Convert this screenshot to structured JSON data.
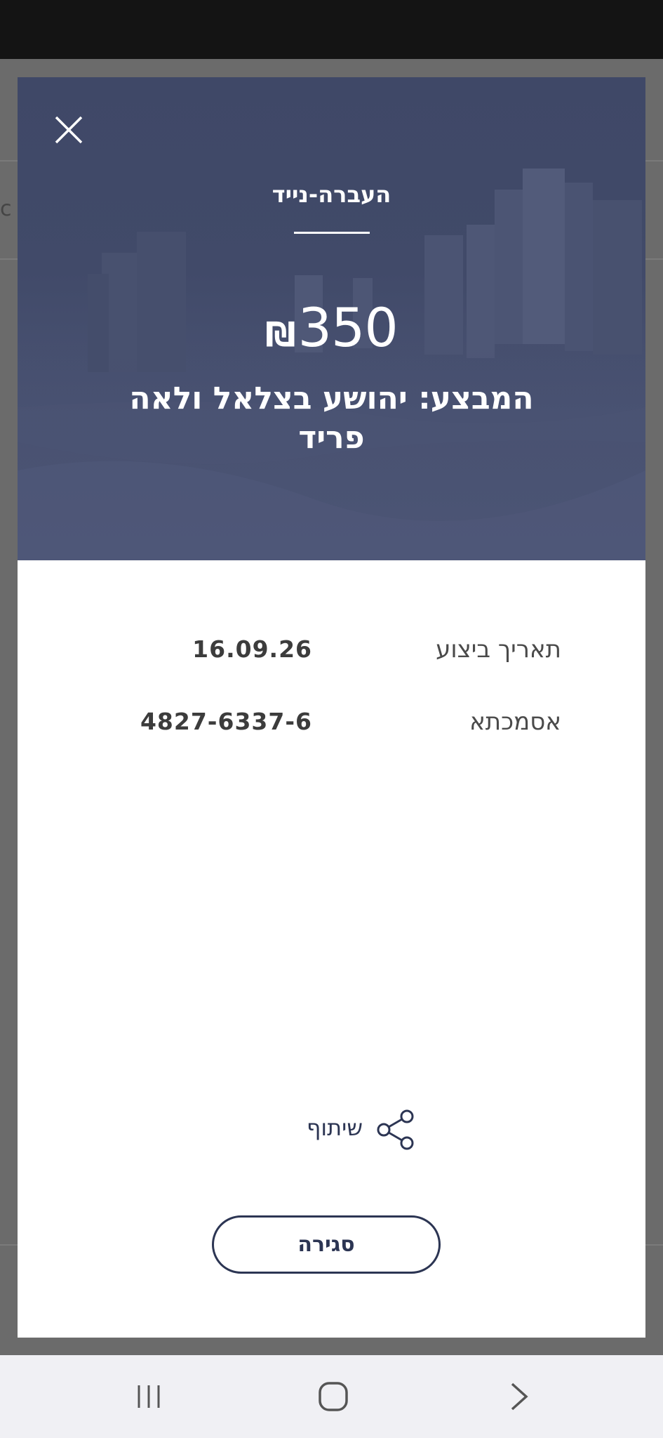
{
  "modal": {
    "transaction_type": "העברה-נייד",
    "amount": "350",
    "currency_symbol": "₪",
    "payer_title": "המבצע: יהושע בצלאל ולאה פריד",
    "details": [
      {
        "label": "תאריך ביצוע",
        "value": "16.09.26"
      },
      {
        "label": "אסמכתא",
        "value": "4827-6337-6"
      }
    ],
    "share_label": "שיתוף",
    "close_button_label": "סגירה"
  },
  "icons": {
    "close": "close-icon",
    "share": "share-icon",
    "nav_recent": "recent-apps-icon",
    "nav_home": "home-icon",
    "nav_back": "back-icon"
  },
  "colors": {
    "hero_background": "#424b6a",
    "primary_text": "#2c3553",
    "status_bar": "#141414",
    "overlay": "#6b6b6b"
  }
}
